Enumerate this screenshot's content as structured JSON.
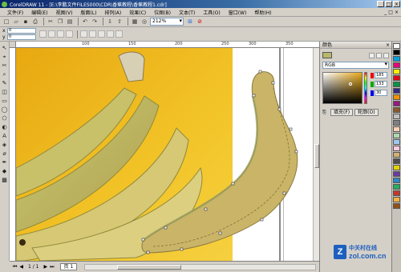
{
  "window": {
    "title": "CorelDRAW 11 - [E:\\李鹏文件FILES000\\CDR\\香蕉教程\\香蕉教程1.cdr]",
    "controls": [
      "_",
      "□",
      "×"
    ]
  },
  "menu": {
    "items": [
      "文件(F)",
      "编辑(E)",
      "视图(V)",
      "版面(L)",
      "排列(A)",
      "效果(C)",
      "位图(B)",
      "文本(T)",
      "工具(O)",
      "窗口(W)",
      "帮助(H)"
    ],
    "doc_controls": [
      "_",
      "□",
      "×"
    ]
  },
  "toolbar": {
    "zoom": "212%"
  },
  "property_bar": {
    "x_label": "x",
    "y_label": "y",
    "x_value": "0",
    "y_value": "0"
  },
  "ruler": {
    "h_ticks": [
      "100",
      "150",
      "200",
      "250",
      "300",
      "350"
    ]
  },
  "status": {
    "pager": "1 / 1",
    "page_tab": "页 1"
  },
  "docker": {
    "title": "颜色",
    "color_model": "RGB",
    "r": "185",
    "g": "133",
    "b": "30",
    "fill_button": "填充(F)",
    "outline_button": "轮廓(O)"
  },
  "palette": {
    "colors": [
      "#ffffff",
      "#000000",
      "#00a0e0",
      "#e6007e",
      "#ffed00",
      "#e30613",
      "#009640",
      "#312783",
      "#f39200",
      "#951b81",
      "#8b5a2b",
      "#c0c0c0",
      "#808080",
      "#fdd2b4",
      "#b0d8b0",
      "#a0c8f0",
      "#f9c9e0",
      "#d4b070",
      "#4d4d4d",
      "#e1d400",
      "#6a3d9a",
      "#2e86c1",
      "#27ae60",
      "#c0392b",
      "#f5b041",
      "#935116"
    ]
  },
  "watermark": {
    "cn": "中关村在线",
    "en": "zol.com.cn",
    "logo_letter": "Z"
  },
  "colors": {
    "banana_fill": "#cbb76a",
    "photo_bg": "#f0c020",
    "accent": "#0a246a"
  }
}
